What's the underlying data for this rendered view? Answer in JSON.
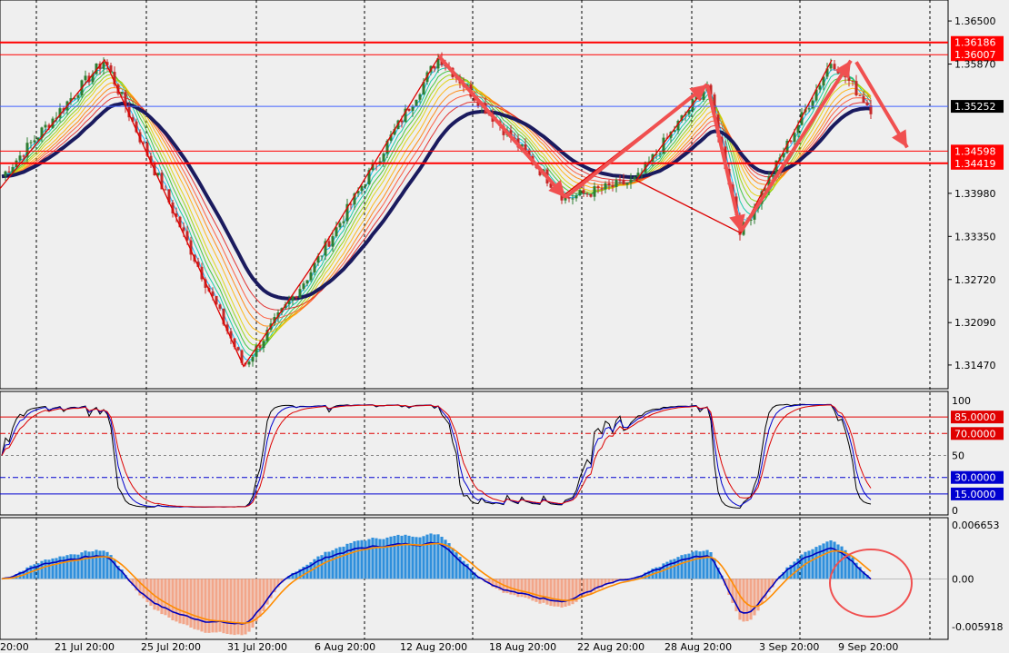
{
  "chart_data": [
    {
      "type": "candlestick",
      "panel": "price",
      "ylim": [
        1.3115,
        1.3678
      ],
      "y_ticks": [
        "1.36500",
        "1.35870",
        "1.35252",
        "1.33980",
        "1.33350",
        "1.32720",
        "1.32090",
        "1.31470"
      ],
      "horizontal_levels": [
        {
          "label": "1.36186",
          "value": 1.36186,
          "color": "#ff0000"
        },
        {
          "label": "1.36007",
          "value": 1.36007,
          "color": "#ff0000"
        },
        {
          "label": "1.34598",
          "value": 1.34598,
          "color": "#ff0000"
        },
        {
          "label": "1.34419",
          "value": 1.34419,
          "color": "#ff0000"
        }
      ],
      "current_price": {
        "label": "1.35252",
        "value": 1.35252
      },
      "x_ticks": [
        "20:00",
        "21 Jul 20:00",
        "25 Jul 20:00",
        "31 Jul 20:00",
        "6 Aug 20:00",
        "12 Aug 20:00",
        "18 Aug 20:00",
        "22 Aug 20:00",
        "28 Aug 20:00",
        "3 Sep 20:00",
        "9 Sep 20:00"
      ],
      "zigzag": [
        [
          0,
          1.3405
        ],
        [
          115,
          1.3593
        ],
        [
          268,
          1.3145
        ],
        [
          340,
          1.3285
        ],
        [
          483,
          1.3598
        ],
        [
          620,
          1.3395
        ],
        [
          778,
          1.3557
        ],
        [
          700,
          1.3417
        ],
        [
          815,
          1.334
        ],
        [
          915,
          1.3593
        ]
      ],
      "key_points": [
        [
          0,
          1.342
        ],
        [
          115,
          1.3593
        ],
        [
          268,
          1.3145
        ],
        [
          340,
          1.328
        ],
        [
          483,
          1.3598
        ],
        [
          622,
          1.339
        ],
        [
          700,
          1.3417
        ],
        [
          778,
          1.3557
        ],
        [
          815,
          1.334
        ],
        [
          915,
          1.3593
        ],
        [
          958,
          1.3522
        ]
      ],
      "colors": {
        "bull": "#2e7d32",
        "bear": "#c62828",
        "ma_slow": "#1a1a5e",
        "arrow": "#f05050"
      }
    },
    {
      "type": "line",
      "panel": "stochastic",
      "ylim": [
        0,
        100
      ],
      "y_ticks": [
        "100",
        "50",
        "0"
      ],
      "levels": [
        {
          "label": "85.0000",
          "value": 85,
          "color": "#e00000"
        },
        {
          "label": "70.0000",
          "value": 70,
          "color": "#e00000"
        },
        {
          "label": "30.0000",
          "value": 30,
          "color": "#0000d0"
        },
        {
          "label": "15.0000",
          "value": 15,
          "color": "#0000d0"
        }
      ],
      "series_colors": [
        "#000000",
        "#0000cc",
        "#dd0000"
      ]
    },
    {
      "type": "histogram",
      "panel": "macd",
      "ylim": [
        -0.005918,
        0.006653
      ],
      "y_ticks": [
        "0.006653",
        "0.00",
        "-0.005918"
      ],
      "colors": {
        "pos": "#2f8fdc",
        "neg": "#f2a68a",
        "fast": "#0000bb",
        "slow": "#ff8c00",
        "circle": "#f05050"
      }
    }
  ]
}
